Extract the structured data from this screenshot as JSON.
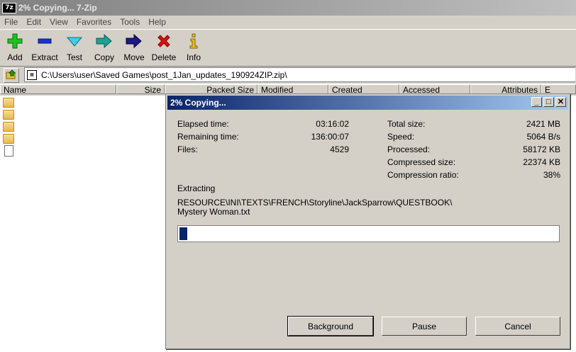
{
  "window": {
    "title": "2% Copying... 7-Zip",
    "logo_text": "7z"
  },
  "menu": [
    "File",
    "Edit",
    "View",
    "Favorites",
    "Tools",
    "Help"
  ],
  "toolbar": {
    "add": "Add",
    "extract": "Extract",
    "test": "Test",
    "copy": "Copy",
    "move": "Move",
    "delete": "Delete",
    "info": "Info"
  },
  "address": {
    "path": "C:\\Users\\user\\Saved Games\\post_1Jan_updates_190924ZIP.zip\\"
  },
  "columns": [
    "Name",
    "Size",
    "Packed Size",
    "Modified",
    "Created",
    "Accessed",
    "Attributes",
    "E"
  ],
  "rows": [
    {
      "type": "folder"
    },
    {
      "type": "folder"
    },
    {
      "type": "folder"
    },
    {
      "type": "folder"
    },
    {
      "type": "file"
    }
  ],
  "dialog": {
    "title": "2% Copying...",
    "elapsed_label": "Elapsed time:",
    "elapsed_value": "03:16:02",
    "remaining_label": "Remaining time:",
    "remaining_value": "136:00:07",
    "files_label": "Files:",
    "files_value": "4529",
    "total_label": "Total size:",
    "total_value": "2421 MB",
    "speed_label": "Speed:",
    "speed_value": "5064 B/s",
    "processed_label": "Processed:",
    "processed_value": "58172 KB",
    "compressed_label": "Compressed size:",
    "compressed_value": "22374 KB",
    "ratio_label": "Compression ratio:",
    "ratio_value": "38%",
    "status_label": "Extracting",
    "current_file_line1": "RESOURCE\\INI\\TEXTS\\FRENCH\\Storyline\\JackSparrow\\QUESTBOOK\\",
    "current_file_line2": "Mystery Woman.txt",
    "progress_percent": 2,
    "background_button": "Background",
    "pause_button": "Pause",
    "cancel_button": "Cancel"
  }
}
